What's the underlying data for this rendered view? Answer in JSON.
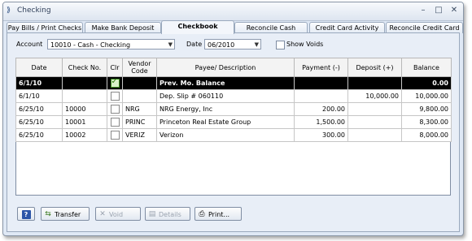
{
  "window": {
    "title": "Checking"
  },
  "tabs": [
    {
      "label": "Pay Bills / Print Checks"
    },
    {
      "label": "Make Bank Deposit"
    },
    {
      "label": "Checkbook"
    },
    {
      "label": "Reconcile Cash"
    },
    {
      "label": "Credit Card Activity"
    },
    {
      "label": "Reconcile Credit Card"
    }
  ],
  "filters": {
    "account_label": "Account",
    "account_value": "10010 - Cash - Checking",
    "date_label": "Date",
    "date_value": "06/2010",
    "show_voids_label": "Show Voids"
  },
  "table": {
    "headers": [
      "Date",
      "Check No.",
      "Clr",
      "Vendor Code",
      "Payee/ Description",
      "Payment (-)",
      "Deposit (+)",
      "Balance"
    ],
    "rows": [
      {
        "date": "6/1/10",
        "check_no": "",
        "clr": true,
        "vendor": "",
        "payee": "Prev. Mo. Balance",
        "payment": "",
        "deposit": "",
        "balance": "0.00"
      },
      {
        "date": "6/1/10",
        "check_no": "",
        "clr": false,
        "vendor": "",
        "payee": "Dep. Slip # 060110",
        "payment": "",
        "deposit": "10,000.00",
        "balance": "10,000.00"
      },
      {
        "date": "6/25/10",
        "check_no": "10000",
        "clr": false,
        "vendor": "NRG",
        "payee": "NRG Energy, Inc",
        "payment": "200.00",
        "deposit": "",
        "balance": "9,800.00"
      },
      {
        "date": "6/25/10",
        "check_no": "10001",
        "clr": false,
        "vendor": "PRINC",
        "payee": "Princeton Real Estate Group",
        "payment": "1,500.00",
        "deposit": "",
        "balance": "8,300.00"
      },
      {
        "date": "6/25/10",
        "check_no": "10002",
        "clr": false,
        "vendor": "VERIZ",
        "payee": "Verizon",
        "payment": "300.00",
        "deposit": "",
        "balance": "8,000.00"
      }
    ]
  },
  "buttons": {
    "transfer": "Transfer",
    "void": "Void",
    "details": "Details",
    "print": "Print..."
  }
}
